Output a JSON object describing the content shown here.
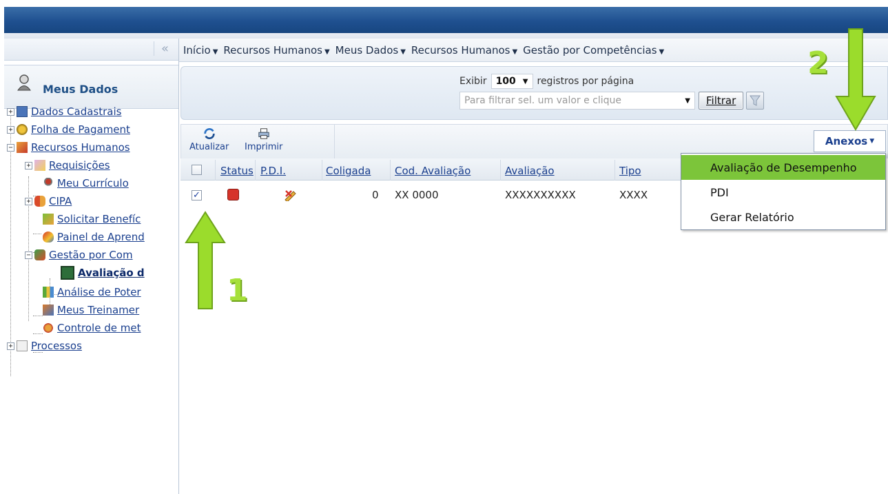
{
  "colors": {
    "accent_green": "#7cc53a",
    "header_blue": "#1f5090",
    "link_blue": "#1a3f8e"
  },
  "sidebar": {
    "collapse_glyph": "«",
    "title": "Meus Dados",
    "items": [
      {
        "label": "Dados Cadastrais",
        "icon": "id-card-icon"
      },
      {
        "label": "Folha de Pagament",
        "icon": "payroll-coins-icon"
      },
      {
        "label": "Recursos Humanos",
        "icon": "hr-icon"
      },
      {
        "label": "Requisições",
        "icon": "request-pencil-icon"
      },
      {
        "label": "Meu Currículo",
        "icon": "person-icon"
      },
      {
        "label": "CIPA",
        "icon": "group-icon"
      },
      {
        "label": "Solicitar Benefíc",
        "icon": "benefit-icon"
      },
      {
        "label": "Painel de Aprend",
        "icon": "learning-panel-icon"
      },
      {
        "label": "Gestão por Com",
        "icon": "competency-icon"
      },
      {
        "label": "Avaliação d",
        "icon": "evaluation-icon"
      },
      {
        "label": "Análise de Poter",
        "icon": "bar-chart-icon"
      },
      {
        "label": "Meus Treinamer",
        "icon": "training-icon"
      },
      {
        "label": "Controle de met",
        "icon": "goals-icon"
      },
      {
        "label": "Processos",
        "icon": "folder-icon"
      }
    ]
  },
  "nav": {
    "items": [
      "Início",
      "Recursos Humanos",
      "Meus Dados",
      "Recursos Humanos",
      "Gestão por Competências"
    ]
  },
  "filter": {
    "exibir_label": "Exibir",
    "per_page_value": "100",
    "per_page_suffix": "registros por página",
    "filter_placeholder": "Para filtrar sel. um valor e clique",
    "filter_button": "Filtrar"
  },
  "toolbar": {
    "refresh_label": "Atualizar",
    "print_label": "Imprimir",
    "anexos_label": "Anexos"
  },
  "grid": {
    "columns": [
      "Status",
      "P.D.I.",
      "Coligada",
      "Cod. Avaliação",
      "Avaliação",
      "Tipo"
    ],
    "rows": [
      {
        "checked": true,
        "status_icon": "status-red-icon",
        "pdi_icon": "pdi-edit-icon",
        "coligada": "0",
        "cod_avaliacao": "XX 0000",
        "avaliacao": "XXXXXXXXXX",
        "tipo": "XXXX"
      }
    ]
  },
  "anexos_menu": {
    "items": [
      "Avaliação de Desempenho",
      "PDI",
      "Gerar Relatório"
    ],
    "highlighted_index": 0
  },
  "annotations": {
    "step1": "1",
    "step2": "2"
  }
}
